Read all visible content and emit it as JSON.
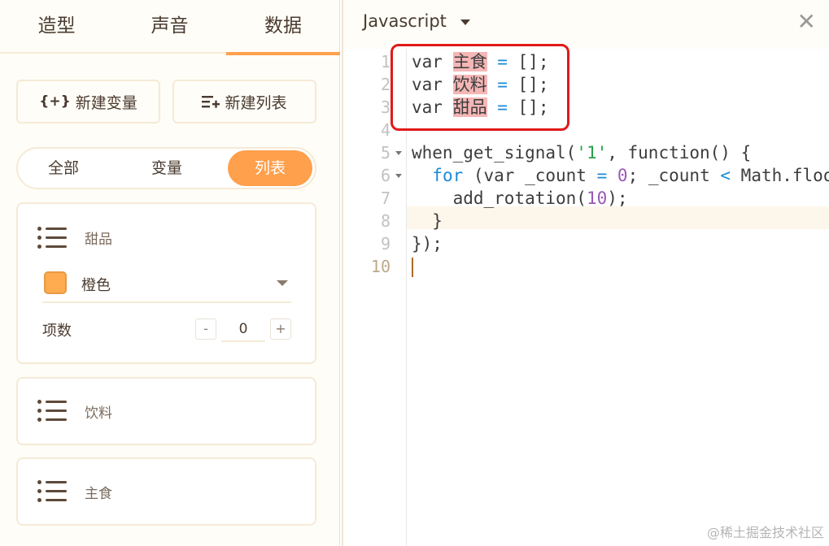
{
  "left": {
    "tabs": [
      "造型",
      "声音",
      "数据"
    ],
    "new_variable_icon": "{+}",
    "new_variable_label": "新建变量",
    "new_list_label": "新建列表",
    "segments": [
      "全部",
      "变量",
      "列表"
    ],
    "lists": [
      {
        "name": "甜品",
        "color_name": "橙色",
        "color_hex": "#ffab4f",
        "count_label": "项数",
        "count_value": "0",
        "minus": "-",
        "plus": "+"
      },
      {
        "name": "饮料"
      },
      {
        "name": "主食"
      }
    ]
  },
  "editor": {
    "language": "Javascript",
    "close_glyph": "✕",
    "line_numbers": [
      "1",
      "2",
      "3",
      "4",
      "5",
      "6",
      "7",
      "8",
      "9",
      "10"
    ],
    "accent": "#ffa04d",
    "highlight_border": "#e01a1a"
  },
  "watermark": "@稀土掘金技术社区"
}
